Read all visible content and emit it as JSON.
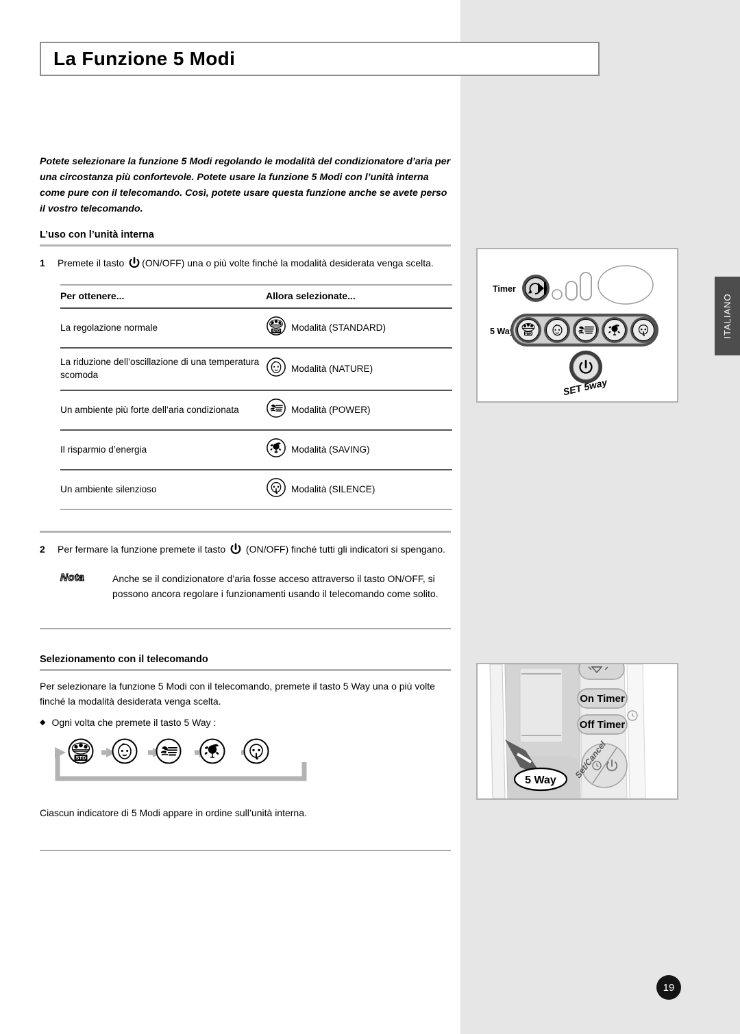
{
  "page": {
    "title": "La Funzione 5 Modi",
    "page_number": "19",
    "language_tab": "ITALIANO"
  },
  "intro": {
    "paragraph": "Potete selezionare la funzione 5 Modi regolando le modalità del condizionatore d’aria per una circostanza più confortevole.  Potete usare la funzione 5 Modi con l’unità interna come pure con il telecomando.  Così, potete usare questa funzione anche se avete perso il vostro telecomando."
  },
  "section_indoor": {
    "heading": "L’uso con l’unità interna",
    "step1": {
      "number": "1",
      "text_before": "Premete il tasto",
      "text_after": "(ON/OFF) una o più volte finché la modalità desiderata venga scelta."
    },
    "step2": {
      "number": "2",
      "text_before": "Per fermare la funzione premete il tasto",
      "text_after": "(ON/OFF) finché tutti gli indicatori si spengano."
    },
    "note": {
      "badge": "Nota",
      "text": "Anche se il condizionatore d’aria fosse acceso attraverso il tasto ON/OFF, si possono ancora regolare i funzionamenti usando il telecomando come solito."
    }
  },
  "modes_table": {
    "headers": [
      "Per ottenere...",
      "Allora selezionate..."
    ],
    "rows": [
      {
        "need": "La regolazione normale",
        "icon": "standard-mode-icon",
        "mode": "Modalità (STANDARD)"
      },
      {
        "need": "La riduzione dell’oscillazione di una temperatura scomoda",
        "icon": "nature-mode-icon",
        "mode": "Modalità (NATURE)"
      },
      {
        "need": "Un ambiente più forte dell’aria condizionata",
        "icon": "power-mode-icon",
        "mode": "Modalità (POWER)"
      },
      {
        "need": "Il risparmio d’energia",
        "icon": "saving-mode-icon",
        "mode": "Modalità (SAVING)"
      },
      {
        "need": "Un ambiente silenzioso",
        "icon": "silence-mode-icon",
        "mode": "Modalità (SILENCE)"
      }
    ]
  },
  "section_remote": {
    "heading": "Selezionamento con il telecomando",
    "paragraph": "Per selezionare la funzione 5 Modi con il telecomando, premete il tasto 5 Way una o più volte finché la modalità desiderata venga scelta.",
    "bullet": "Ogni volta che premete il tasto 5 Way :",
    "closing": "Ciascun indicatore di 5 Modi appare in ordine sull’unità interna."
  },
  "flow_sequence": [
    "standard-mode-icon",
    "nature-mode-icon",
    "power-mode-icon",
    "saving-mode-icon",
    "silence-mode-icon"
  ],
  "illustration_indoor": {
    "label_timer": "Timer",
    "label_5way": "5 Way",
    "label_set": "SET 5way"
  },
  "illustration_remote": {
    "btn_on_timer": "On Timer",
    "btn_off_timer": "Off Timer",
    "btn_set_cancel": "Set/Cancel",
    "callout_5way": "5 Way"
  },
  "colors": {
    "panel_gray": "#e6e6e6",
    "tab_dark": "#4d4d4d",
    "rule_gray": "#a9a9a9"
  }
}
